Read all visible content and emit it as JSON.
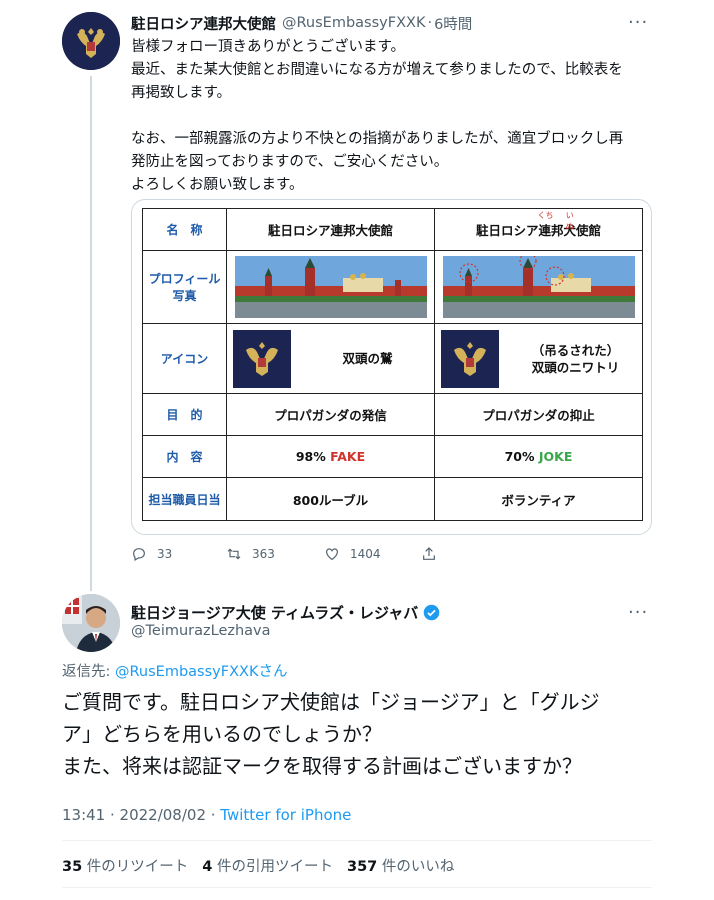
{
  "tweet1": {
    "name": "駐日ロシア連邦大使館",
    "handle": "@RusEmbassyFXXK",
    "separator": "·",
    "time": "6時間",
    "more": "···",
    "lines": [
      "皆様フォロー頂きありがとうございます。",
      "最近、また某大使館とお間違いになる方が増えて参りましたので、比較表を",
      "再掲致します。",
      "",
      "なお、一部親露派の方より不快との指摘がありましたが、適宜ブロックし再",
      "発防止を図っておりますので、ご安心ください。",
      "よろしくお願い致します。"
    ],
    "table": {
      "name_label": "名　称",
      "col1_name": "駐日ロシア連邦大使館",
      "col2_name_pre": "駐日ロシア連邦",
      "col2_name_dog": "犬",
      "col2_name_post": "使館",
      "ruby_kuchi": "くち",
      "ruby_inu": "いぬ",
      "photo_label_1": "プロフィール",
      "photo_label_2": "写真",
      "icon_label": "アイコン",
      "col1_icon_text": "双頭の鷲",
      "col2_icon_text_1": "（吊るされた）",
      "col2_icon_text_2": "双頭のニワトリ",
      "purpose_label": "目　的",
      "col1_purpose": "プロパガンダの発信",
      "col2_purpose": "プロパガンダの抑止",
      "content_label": "内　容",
      "col1_content_pct": "98%",
      "col1_content_word": "FAKE",
      "col2_content_pct": "70%",
      "col2_content_word": "JOKE",
      "wage_label": "担当職員日当",
      "col1_wage": "800ルーブル",
      "col2_wage": "ボランティア"
    },
    "actions": {
      "replies": "33",
      "retweets": "363",
      "likes": "1404"
    }
  },
  "tweet2": {
    "name": "駐日ジョージア大使 ティムラズ・レジャバ",
    "handle": "@TeimurazLezhava",
    "more": "···",
    "reply_prefix": "返信先: ",
    "reply_handle": "@RusEmbassyFXXK",
    "reply_suffix": "さん",
    "lines": [
      "ご質問です。駐日ロシア犬使館は「ジョージア」と「グルジ",
      "ア」どちらを用いるのでしょうか？",
      "また、将来は認証マークを取得する計画はございますか？"
    ],
    "time": "13:41 · 2022/08/02 · ",
    "source": "Twitter for iPhone",
    "stats": {
      "retweets_count": "35",
      "retweets_label": "件のリツイート",
      "quotes_count": "4",
      "quotes_label": "件の引用ツイート",
      "likes_count": "357",
      "likes_label": "件のいいね"
    }
  },
  "colors": {
    "accent": "#1d9bf0",
    "secondary_text": "#536471",
    "fake": "#d0342c",
    "joke": "#3aa64a",
    "label_blue": "#1f5ba8",
    "emblem_navy": "#1c2452"
  }
}
